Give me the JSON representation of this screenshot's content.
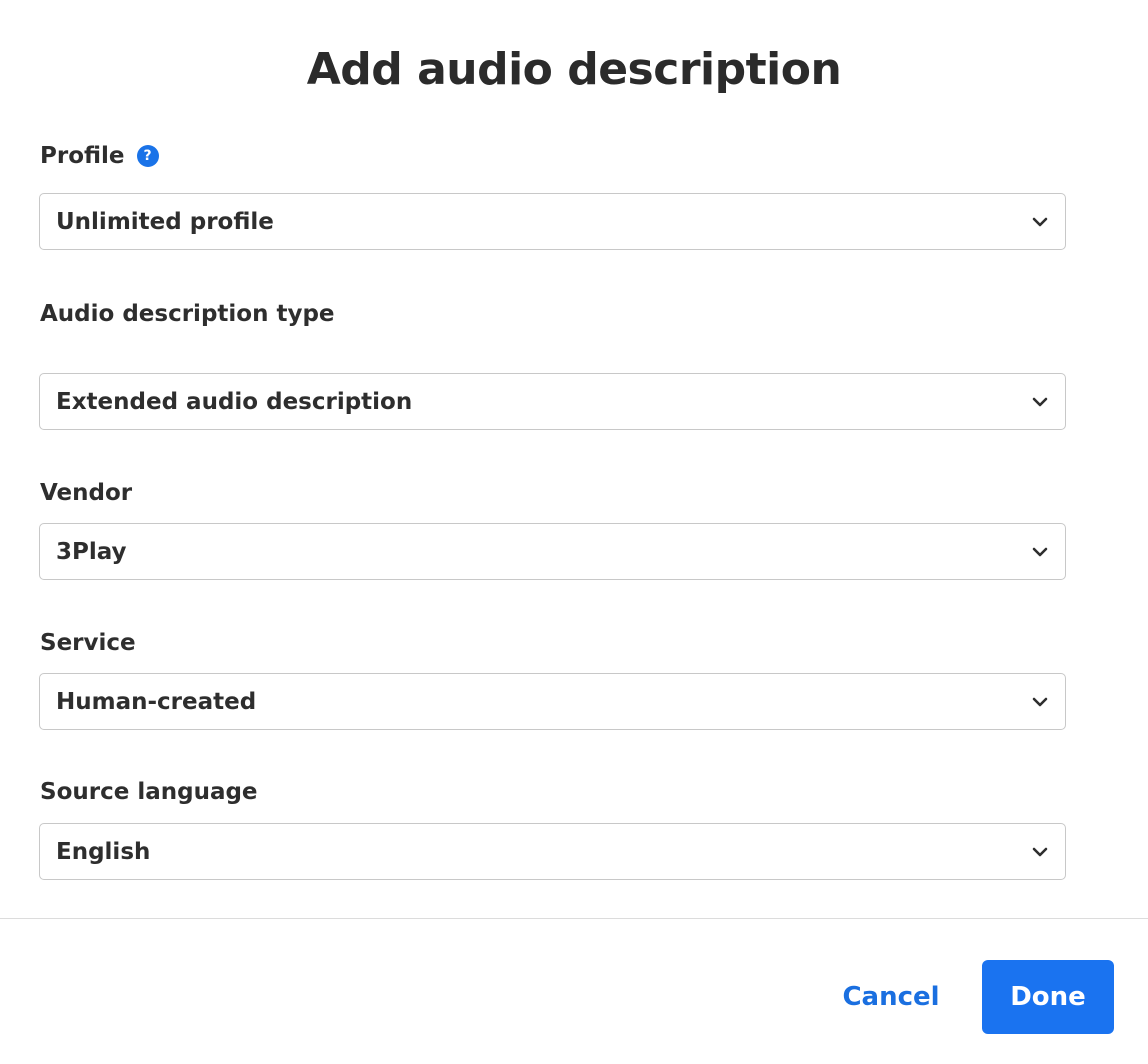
{
  "dialog": {
    "title": "Add audio description"
  },
  "fields": {
    "profile": {
      "label": "Profile",
      "help_icon_text": "?",
      "value": "Unlimited profile"
    },
    "ad_type": {
      "label": "Audio description type",
      "value": "Extended audio description"
    },
    "vendor": {
      "label": "Vendor",
      "value": "3Play"
    },
    "service": {
      "label": "Service",
      "value": "Human-created"
    },
    "source_language": {
      "label": "Source language",
      "value": "English"
    }
  },
  "footer": {
    "cancel_label": "Cancel",
    "done_label": "Done"
  },
  "colors": {
    "accent": "#1a73f0",
    "text": "#2e2e2e",
    "border": "#c8c8c8"
  },
  "icons": {
    "help": "question-circle-icon",
    "dropdown": "chevron-down-icon"
  }
}
